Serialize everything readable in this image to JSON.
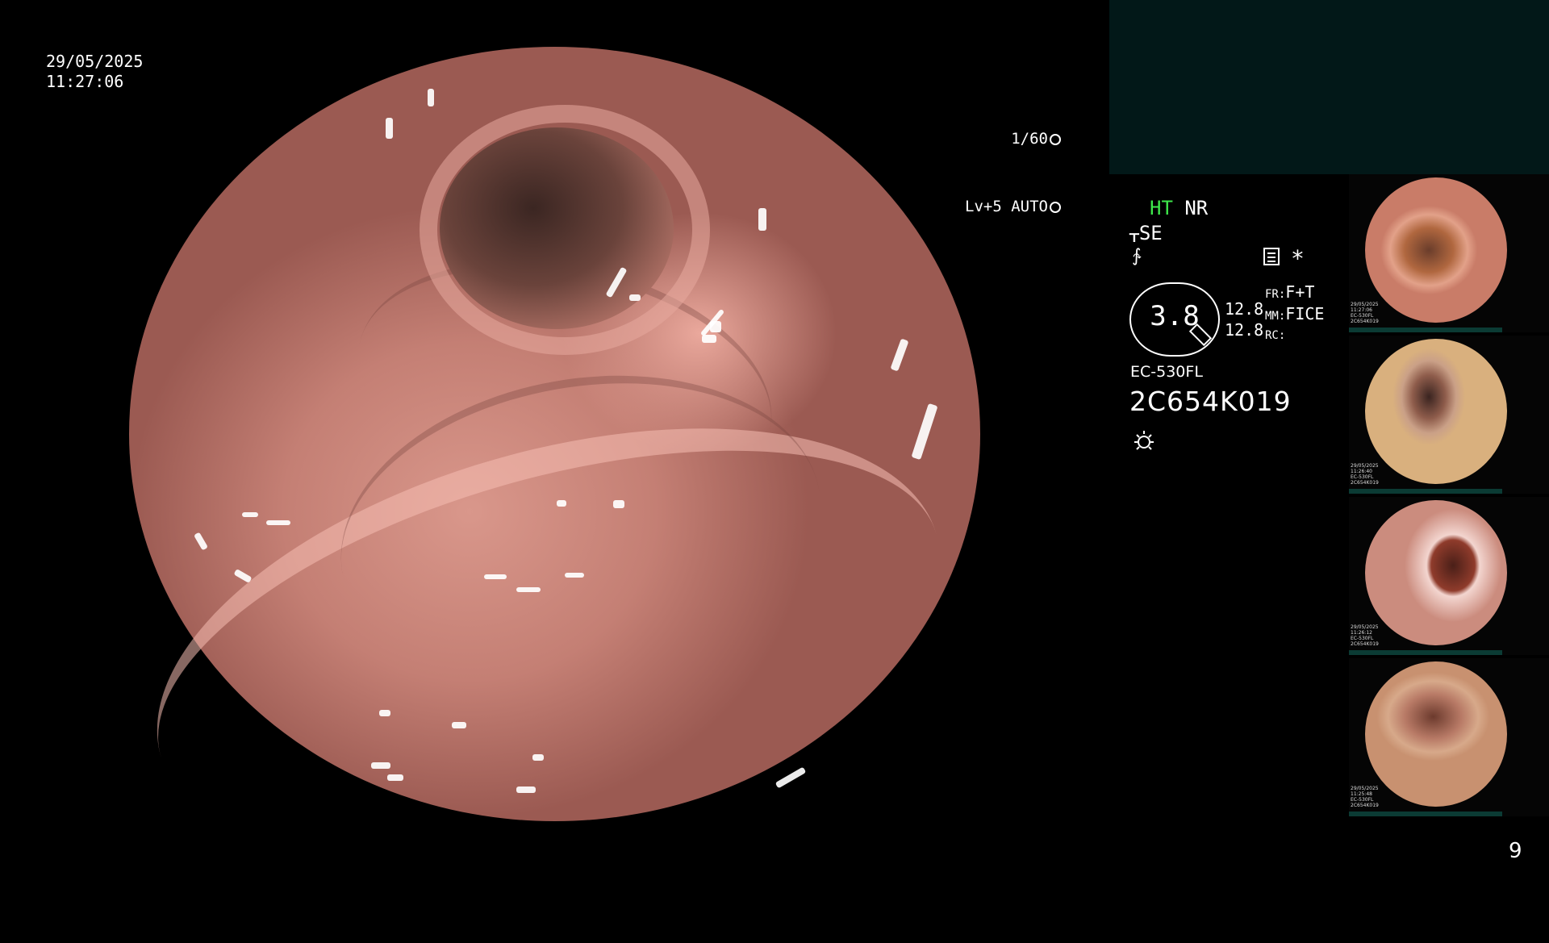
{
  "overlay": {
    "date": "29/05/2025",
    "time": "11:27:06",
    "shutter": "1/60",
    "level": "Lv+5 AUTO"
  },
  "status": {
    "ht": "HT",
    "nr": "NR",
    "se": "SE",
    "octagon_value": "3.8",
    "num_a": "12.8",
    "num_b": "12.8",
    "fr_label": "FR:",
    "fr_value": "F+T",
    "mm_label": "MM:",
    "mm_value": "FICE",
    "rc_label": "RC:",
    "model": "EC-530FL",
    "serial": "2C654K019",
    "ht_color": "#3ee84b"
  },
  "thumbnails": [
    {
      "meta": "29/05/2025\n11:27:06\nEC-530FL\n2C654K019"
    },
    {
      "meta": "29/05/2025\n11:26:40\nEC-530FL\n2C654K019"
    },
    {
      "meta": "29/05/2025\n11:26:12\nEC-530FL\n2C654K019"
    },
    {
      "meta": "29/05/2025\n11:25:48\nEC-530FL\n2C654K019"
    }
  ],
  "page_number": "9"
}
